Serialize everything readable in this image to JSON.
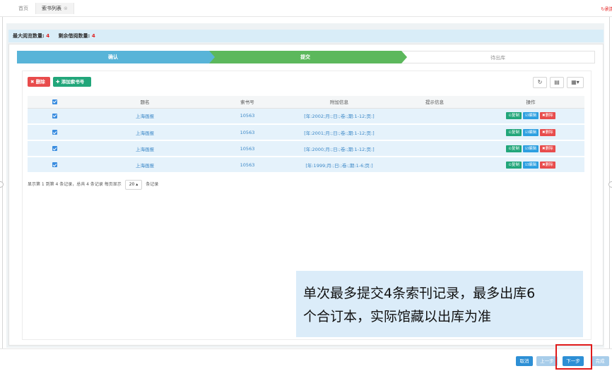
{
  "tabs": [
    {
      "label": "首页"
    },
    {
      "label": "索书列表",
      "close": "⊗"
    }
  ],
  "refresh_label": "↻刷新",
  "info": {
    "max_view_label": "最大阅览数量:",
    "max_view_value": "4",
    "remaining_label": "剩余借阅数量:",
    "remaining_value": "4"
  },
  "wizard": {
    "steps": [
      {
        "label": "确认",
        "state": "done"
      },
      {
        "label": "提交",
        "state": "active"
      },
      {
        "label": "待出库",
        "state": "pending"
      }
    ]
  },
  "toolbar": {
    "delete_label": "✖ 删除",
    "add_label": "✚ 添加索书号",
    "refresh_icon": "refresh-icon",
    "columns_icon": "columns-icon",
    "grid_icon": "grid-icon"
  },
  "table": {
    "headers": [
      "",
      "题名",
      "索书号",
      "附加信息",
      "提示信息",
      "操作"
    ],
    "rows": [
      {
        "title": "上海画报",
        "call_no": "10563",
        "extra": "[年:2002;月:;日:;卷:;期:1-12;页:]",
        "hint": ""
      },
      {
        "title": "上海画报",
        "call_no": "10563",
        "extra": "[年:2001;月:;日:;卷:;期:1-12;页:]",
        "hint": ""
      },
      {
        "title": "上海画报",
        "call_no": "10563",
        "extra": "[年:2000;月:;日:;卷:;期:1-12;页:]",
        "hint": ""
      },
      {
        "title": "上海画报",
        "call_no": "10563",
        "extra": "[年:1999;月:;日:;卷:;期:1-6;页:]",
        "hint": ""
      }
    ],
    "actions": {
      "copy": "⊙复制",
      "edit": "☑编辑",
      "delete": "✖删除"
    }
  },
  "pager": {
    "summary": "显示第 1 到第 4 条记录，总共 4 条记录 每页显示",
    "page_size": "20 ▴",
    "suffix": "条记录"
  },
  "note": {
    "line1": "单次最多提交4条索刊记录，最多出库6",
    "line2": "个合订本，实际馆藏以出库为准"
  },
  "footer": {
    "cancel": "取消",
    "prev": "上一步",
    "next": "下一步",
    "done": "完成"
  },
  "colors": {
    "step_done": "#58b4d8",
    "step_active": "#5cb85c",
    "primary": "#2d8fd5",
    "danger": "#e84c4c",
    "success": "#22a67a"
  }
}
